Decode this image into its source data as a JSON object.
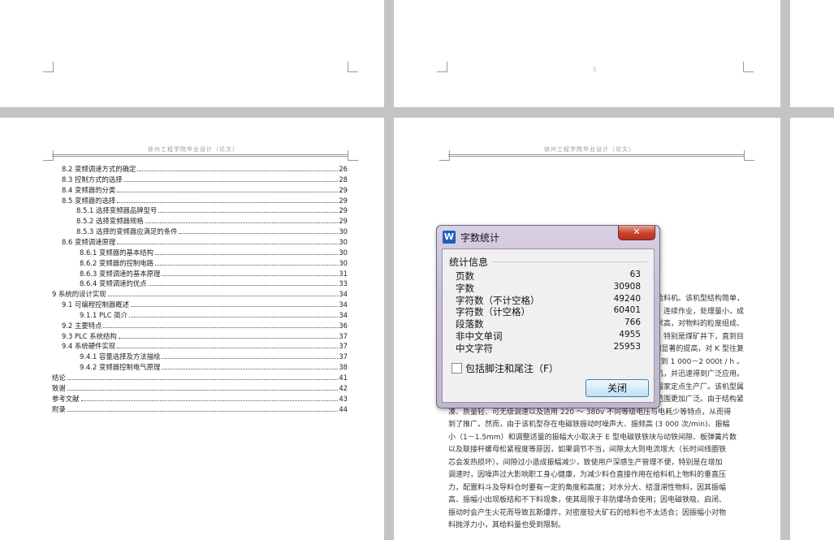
{
  "document": {
    "running_header": "徐州工程学院毕业设计（论文）",
    "toc": [
      {
        "title": "8.2  变频调速方式的确定",
        "page": "26",
        "indent": 1
      },
      {
        "title": "8.3  控制方式的选择",
        "page": "28",
        "indent": 1
      },
      {
        "title": "8.4  变频器的分类",
        "page": "29",
        "indent": 1
      },
      {
        "title": "8.5  变频器的选择",
        "page": "29",
        "indent": 1
      },
      {
        "title": "8.5.1 选择变频器品牌型号",
        "page": "29",
        "indent": 2
      },
      {
        "title": "8.5.2 选择变频器规格",
        "page": "29",
        "indent": 2
      },
      {
        "title": "8.5.3 选择的变频器应满足的条件",
        "page": "30",
        "indent": 2
      },
      {
        "title": "8.6  变频调速原理",
        "page": "30",
        "indent": 1
      },
      {
        "title": "8.6.1 变频器的基本结构",
        "page": "30",
        "indent": 3
      },
      {
        "title": "8.6.2 变频器的控制电路",
        "page": "30",
        "indent": 3
      },
      {
        "title": "8.6.3 变频调速的基本原理",
        "page": "31",
        "indent": 3
      },
      {
        "title": "8.6.4 变频调速的优点",
        "page": "33",
        "indent": 3
      },
      {
        "title": "9  系统的设计实现",
        "page": "34",
        "indent": 0
      },
      {
        "title": "9.1  可编程控制器概述",
        "page": "34",
        "indent": 1
      },
      {
        "title": "9.1.1 PLC 简介",
        "page": "34",
        "indent": 3
      },
      {
        "title": "9.2  主要特点",
        "page": "36",
        "indent": 1
      },
      {
        "title": "9.3  PLC 系统结构",
        "page": "37",
        "indent": 1
      },
      {
        "title": "9.4  系统硬件实现",
        "page": "37",
        "indent": 1
      },
      {
        "title": "9.4.1 容量选择及方法描绘",
        "page": "37",
        "indent": 3
      },
      {
        "title": "9.4.2 变频器控制电气原理",
        "page": "38",
        "indent": 3
      },
      {
        "title": "结论",
        "page": "41",
        "indent": 0
      },
      {
        "title": "致谢",
        "page": "42",
        "indent": 0
      },
      {
        "title": "参考文献",
        "page": "43",
        "indent": 0
      },
      {
        "title": "附录",
        "page": "44",
        "indent": 0
      }
    ],
    "body_lines": [
      "给料机。该机型结构简单，",
      "连续作业，处理量小，成",
      "求高，对物料的粒度组成、",
      "特别是煤矿井下，直到目",
      "得到显著的提高，对 K 型往复",
      "能达到 1 000－2 000t / h 。",
      "机，并迅速得到广泛应用。",
      "国家定点生产厂。该机型属",
      "范围更加广泛。由于结构紧",
      "凑、质量轻、可无级调速以及适用 220 ～ 380v 不同等级电压与电耗少等特点，从而得",
      "到了推广。然而，由于该机型存在电磁铁振动时噪声大、振频高 (3 000 次/min)、振幅",
      "小（1－1.5mm）和调整适量的振幅大小取决于 E 型电磁铁铁块与动铁间隙、板弹簧片数",
      "以及联接杆螺母松紧程度等原因，如果调节不当，间隙太大则电流增大（长时间线圈铁",
      "芯会发热损坏）。间隙过小造成振幅减少，致使用户深感生产管理不便，特别是在增加",
      "调速时，因噪声过大影响职工身心健康，为减少料仓直接作用在给料机上物料的垂直压",
      "力，配置料斗及导料仓时要有一定的角度和高度；对水分大、结湿滞性物料，因其振幅",
      "高、振幅小出现板结和不下料现象，使其局限于非防爆场合使用；因电磁铁吸、启闭、",
      "振动时会产生火花而导致瓦斯爆炸，对密度较大矿石的给料也不太适合；因振幅小对物",
      "料抛浮力小，其给料量也受到限制。"
    ],
    "page_mark": "||"
  },
  "dialog": {
    "title": "字数统计",
    "close_glyph": "✕",
    "app_icon": "W",
    "group_label": "统计信息",
    "stats": [
      {
        "label": "页数",
        "value": "63"
      },
      {
        "label": "字数",
        "value": "30908"
      },
      {
        "label": "字符数（不计空格）",
        "value": "49240"
      },
      {
        "label": "字符数（计空格）",
        "value": "60401"
      },
      {
        "label": "段落数",
        "value": "766"
      },
      {
        "label": "非中文单词",
        "value": "4955"
      },
      {
        "label": "中文字符",
        "value": "25953"
      }
    ],
    "include_footnotes_label": "包括脚注和尾注（F）",
    "include_footnotes_checked": false,
    "close_button_label": "关闭"
  }
}
